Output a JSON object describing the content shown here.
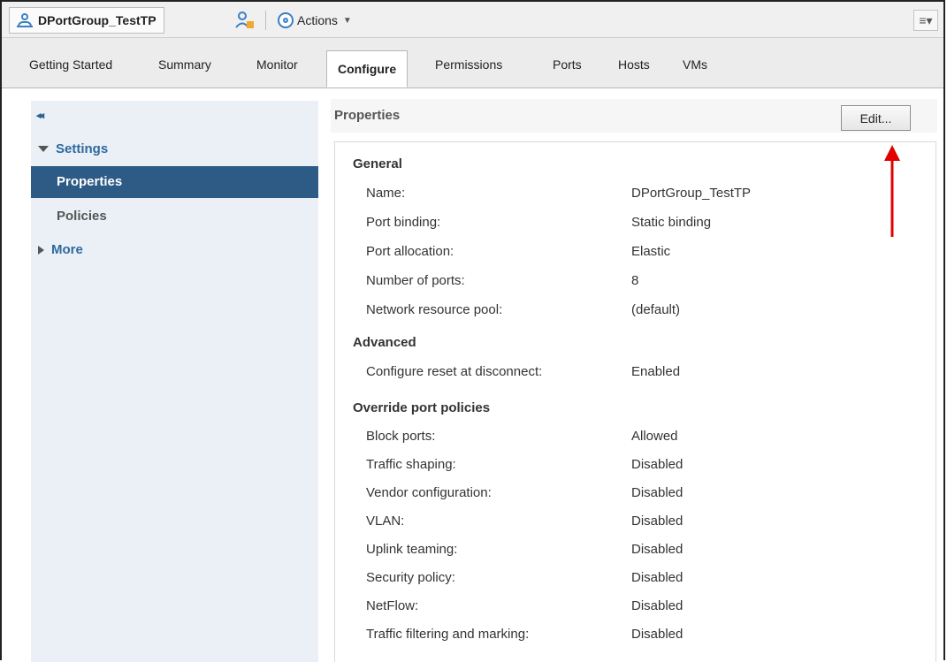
{
  "titlebar": {
    "object_name": "DPortGroup_TestTP",
    "actions_label": "Actions",
    "icons": [
      "portgroup-icon",
      "users-icon",
      "gear-icon",
      "menu-icon"
    ]
  },
  "tabs": [
    {
      "label": "Getting Started"
    },
    {
      "label": "Summary"
    },
    {
      "label": "Monitor"
    },
    {
      "label": "Configure",
      "active": true
    },
    {
      "label": "Permissions"
    },
    {
      "label": "Ports"
    },
    {
      "label": "Hosts"
    },
    {
      "label": "VMs"
    }
  ],
  "nav": {
    "collapse_icon": "◂◂",
    "settings_label": "Settings",
    "items": [
      {
        "label": "Properties",
        "selected": true
      },
      {
        "label": "Policies",
        "selected": false
      }
    ],
    "more_label": "More"
  },
  "main": {
    "title": "Properties",
    "edit_label": "Edit...",
    "sections": [
      {
        "title": "General",
        "rows": [
          {
            "label": "Name:",
            "value": "DPortGroup_TestTP"
          },
          {
            "label": "Port binding:",
            "value": "Static binding"
          },
          {
            "label": "Port allocation:",
            "value": "Elastic"
          },
          {
            "label": "Number of ports:",
            "value": "8"
          },
          {
            "label": "Network resource pool:",
            "value": "(default)"
          }
        ]
      },
      {
        "title": "Advanced",
        "rows": [
          {
            "label": "Configure reset at disconnect:",
            "value": "Enabled"
          }
        ]
      },
      {
        "title": "Override port policies",
        "rows": [
          {
            "label": "Block ports:",
            "value": "Allowed"
          },
          {
            "label": "Traffic shaping:",
            "value": "Disabled"
          },
          {
            "label": "Vendor configuration:",
            "value": "Disabled"
          },
          {
            "label": "VLAN:",
            "value": "Disabled"
          },
          {
            "label": "Uplink teaming:",
            "value": "Disabled"
          },
          {
            "label": "Security policy:",
            "value": "Disabled"
          },
          {
            "label": "NetFlow:",
            "value": "Disabled"
          },
          {
            "label": "Traffic filtering and marking:",
            "value": "Disabled"
          }
        ]
      }
    ]
  },
  "colors": {
    "accent": "#2d5b85",
    "annotation_arrow": "#e00000"
  }
}
